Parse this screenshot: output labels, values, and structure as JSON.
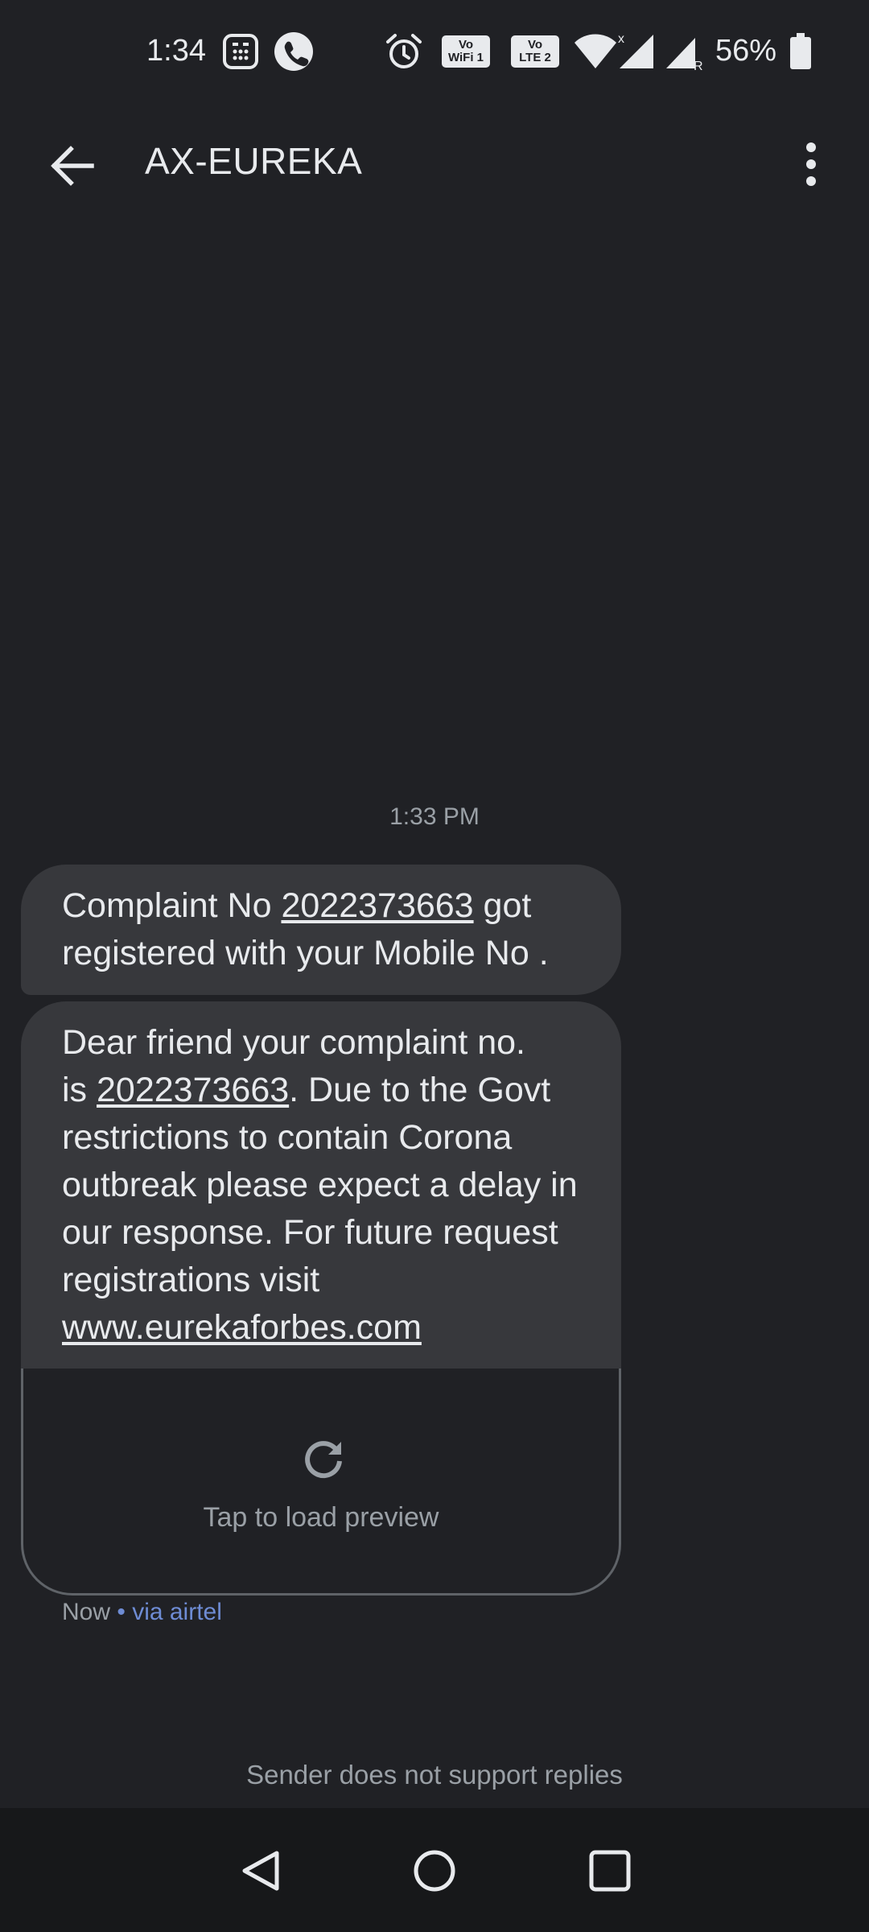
{
  "status_bar": {
    "time": "1:34",
    "sim1_badge": "Vo WiFi 1",
    "sim2_badge": "Vo LTE 2",
    "battery": "56%"
  },
  "app_bar": {
    "title": "AX-EUREKA"
  },
  "conversation": {
    "timestamp": "1:33 PM",
    "message1": {
      "before": "Complaint No ",
      "link": "2022373663",
      "after": " got registered with your Mobile No ."
    },
    "message2": {
      "line1": "Dear friend your complaint no.",
      "is": "is ",
      "link": "2022373663",
      "rest": ". Due to the Govt restrictions to contain Corona outbreak please expect a delay in our response. For future request registrations visit ",
      "url": "www.eurekaforbes.com"
    },
    "preview_label": "Tap to load preview",
    "meta_time": "Now",
    "meta_via": " • via airtel"
  },
  "footer": {
    "no_reply": "Sender does not support replies"
  },
  "colors": {
    "background": "#202125",
    "bubble": "#37383c",
    "link_meta": "#6e8cd4"
  }
}
